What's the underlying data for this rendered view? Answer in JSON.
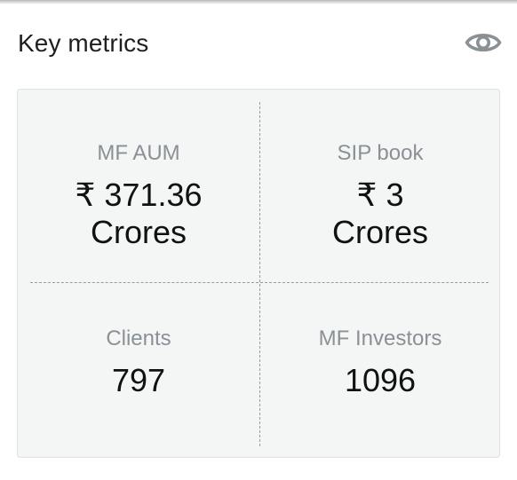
{
  "header": {
    "title": "Key metrics",
    "visibility_icon": "eye-icon"
  },
  "metrics": [
    {
      "label": "MF AUM",
      "value_line1": "₹ 371.36",
      "value_line2": "Crores"
    },
    {
      "label": "SIP book",
      "value_line1": "₹ 3",
      "value_line2": "Crores"
    },
    {
      "label": "Clients",
      "value": "797"
    },
    {
      "label": "MF Investors",
      "value": "1096"
    }
  ],
  "colors": {
    "card_background": "#f4f5f5",
    "label_text": "#8a9196",
    "value_text": "#111111",
    "icon": "#8a9196"
  }
}
